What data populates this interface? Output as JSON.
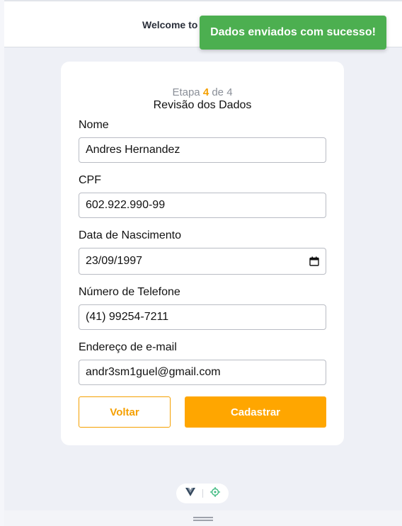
{
  "header": {
    "title": "Welcome to"
  },
  "toast": {
    "message": "Dados enviados com sucesso!"
  },
  "form": {
    "step_prefix": "Etapa",
    "step_current": "4",
    "step_separator": "de 4",
    "step_title": "Revisão dos Dados",
    "fields": [
      {
        "label": "Nome",
        "value": "Andres Hernandez"
      },
      {
        "label": "CPF",
        "value": "602.922.990-99"
      },
      {
        "label": "Data de Nascimento",
        "value": "23/09/1997"
      },
      {
        "label": "Número de Telefone",
        "value": "(41) 99254-7211"
      },
      {
        "label": "Endereço de e-mail",
        "value": "andr3sm1guel@gmail.com"
      }
    ],
    "back_label": "Voltar",
    "submit_label": "Cadastrar"
  },
  "colors": {
    "accent": "#ffa600",
    "toast_bg": "#4caf50",
    "page_bg": "#eef0f6"
  },
  "devtools": {
    "icons": [
      "vue-logo-icon",
      "target-icon"
    ]
  }
}
